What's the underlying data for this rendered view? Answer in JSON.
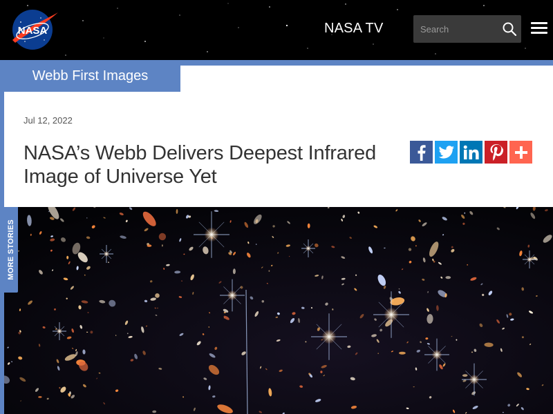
{
  "header": {
    "logo_icon": "nasa-meatball-logo",
    "logo_text": "NASA",
    "nav_link": "NASA TV",
    "search": {
      "placeholder": "Search",
      "icon": "search-icon"
    },
    "menu_icon": "hamburger-menu-icon"
  },
  "tag": {
    "label": "Webb First Images"
  },
  "article": {
    "date": "Jul 12, 2022",
    "title": "NASA’s Webb Delivers Deepest Infrared Image of Universe Yet"
  },
  "share": [
    {
      "name": "facebook",
      "icon": "facebook-icon",
      "color": "#3b5998"
    },
    {
      "name": "twitter",
      "icon": "twitter-icon",
      "color": "#1da1f2"
    },
    {
      "name": "linkedin",
      "icon": "linkedin-icon",
      "color": "#0077b5"
    },
    {
      "name": "pinterest",
      "icon": "pinterest-icon",
      "color": "#cb2027"
    },
    {
      "name": "addthis",
      "icon": "plus-icon",
      "color": "#ff6550"
    }
  ],
  "sidebar": {
    "more_stories_label": "MORE STORIES"
  },
  "colors": {
    "accent": "#5d84c4",
    "header_bg": "#000000",
    "text": "#333333"
  }
}
